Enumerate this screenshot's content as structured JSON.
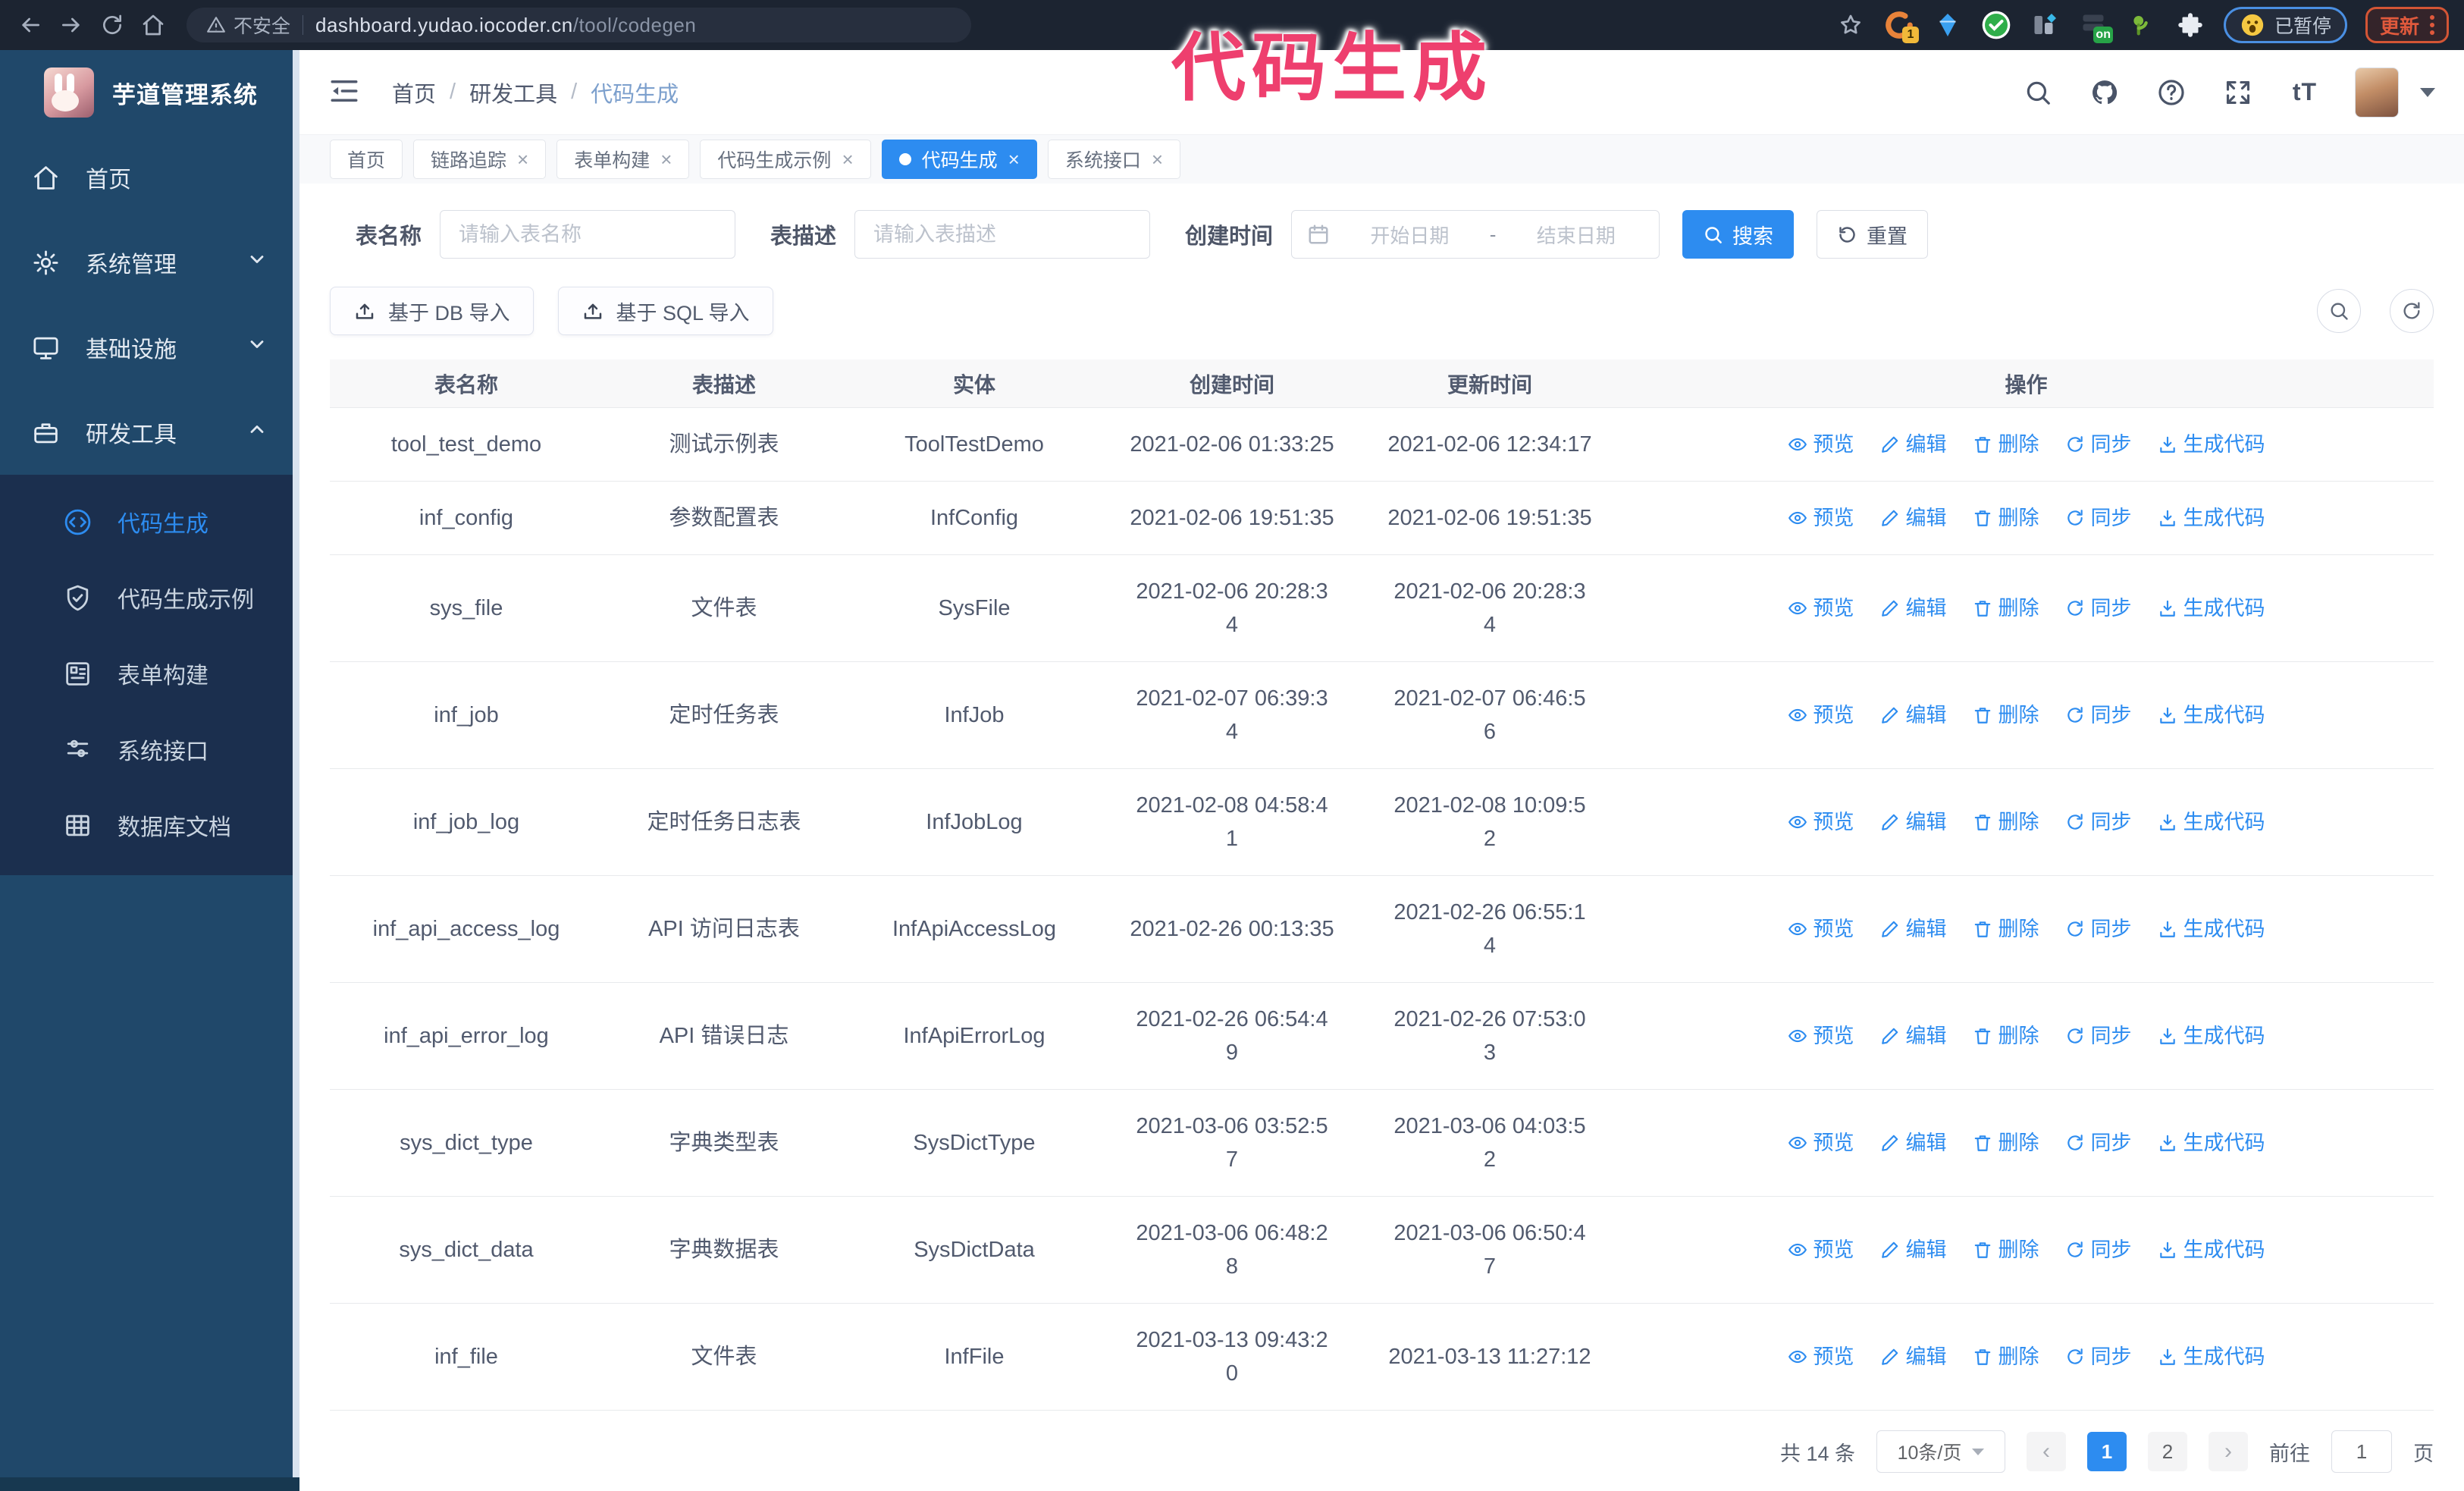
{
  "colors": {
    "primary": "#2d8cf0",
    "annotation_pink": "#ee3f6e",
    "sidebar_bg": "#20486a",
    "submenu_bg": "#1b2f4e",
    "chrome_bg": "#1c2431"
  },
  "browser": {
    "security_label": "不安全",
    "url_host": "dashboard.yudao.iocoder.cn",
    "url_path": "/tool/codegen",
    "extension_badge_1": "1",
    "extension_badge_on": "on",
    "paused_badge": "已暂停",
    "update_button": "更新"
  },
  "annotation": {
    "text": "代码生成"
  },
  "sidebar": {
    "app_title": "芋道管理系统",
    "items": [
      {
        "label": "首页"
      },
      {
        "label": "系统管理"
      },
      {
        "label": "基础设施"
      },
      {
        "label": "研发工具"
      }
    ],
    "submenu": [
      {
        "label": "代码生成",
        "active": true
      },
      {
        "label": "代码生成示例"
      },
      {
        "label": "表单构建"
      },
      {
        "label": "系统接口"
      },
      {
        "label": "数据库文档"
      }
    ]
  },
  "header": {
    "breadcrumb": [
      "首页",
      "研发工具",
      "代码生成"
    ],
    "separator": "/"
  },
  "tabs": [
    {
      "label": "首页"
    },
    {
      "label": "链路追踪"
    },
    {
      "label": "表单构建"
    },
    {
      "label": "代码生成示例"
    },
    {
      "label": "代码生成"
    },
    {
      "label": "系统接口"
    }
  ],
  "search": {
    "name_label": "表名称",
    "name_placeholder": "请输入表名称",
    "desc_label": "表描述",
    "desc_placeholder": "请输入表描述",
    "time_label": "创建时间",
    "start_placeholder": "开始日期",
    "range_separator": "-",
    "end_placeholder": "结束日期",
    "search_button": "搜索",
    "reset_button": "重置"
  },
  "toolbar": {
    "db_import": "基于 DB 导入",
    "sql_import": "基于 SQL 导入"
  },
  "table": {
    "columns": [
      "表名称",
      "表描述",
      "实体",
      "创建时间",
      "更新时间",
      "操作"
    ],
    "actions": [
      "预览",
      "编辑",
      "删除",
      "同步",
      "生成代码"
    ],
    "rows": [
      [
        "tool_test_demo",
        "测试示例表",
        "ToolTestDemo",
        "2021-02-06 01:33:25",
        "2021-02-06 12:34:17"
      ],
      [
        "inf_config",
        "参数配置表",
        "InfConfig",
        "2021-02-06 19:51:35",
        "2021-02-06 19:51:35"
      ],
      [
        "sys_file",
        "文件表",
        "SysFile",
        "2021-02-06 20:28:3\n4",
        "2021-02-06 20:28:3\n4"
      ],
      [
        "inf_job",
        "定时任务表",
        "InfJob",
        "2021-02-07 06:39:3\n4",
        "2021-02-07 06:46:5\n6"
      ],
      [
        "inf_job_log",
        "定时任务日志表",
        "InfJobLog",
        "2021-02-08 04:58:4\n1",
        "2021-02-08 10:09:5\n2"
      ],
      [
        "inf_api_access_log",
        "API 访问日志表",
        "InfApiAccessLog",
        "2021-02-26 00:13:35",
        "2021-02-26 06:55:1\n4"
      ],
      [
        "inf_api_error_log",
        "API 错误日志",
        "InfApiErrorLog",
        "2021-02-26 06:54:4\n9",
        "2021-02-26 07:53:0\n3"
      ],
      [
        "sys_dict_type",
        "字典类型表",
        "SysDictType",
        "2021-03-06 03:52:5\n7",
        "2021-03-06 04:03:5\n2"
      ],
      [
        "sys_dict_data",
        "字典数据表",
        "SysDictData",
        "2021-03-06 06:48:2\n8",
        "2021-03-06 06:50:4\n7"
      ],
      [
        "inf_file",
        "文件表",
        "InfFile",
        "2021-03-13 09:43:2\n0",
        "2021-03-13 11:27:12"
      ]
    ]
  },
  "pagination": {
    "total": "共 14 条",
    "page_size": "10条/页",
    "pages": [
      "1",
      "2"
    ],
    "active_page": "1",
    "goto_label": "前往",
    "goto_value": "1",
    "goto_suffix": "页"
  }
}
